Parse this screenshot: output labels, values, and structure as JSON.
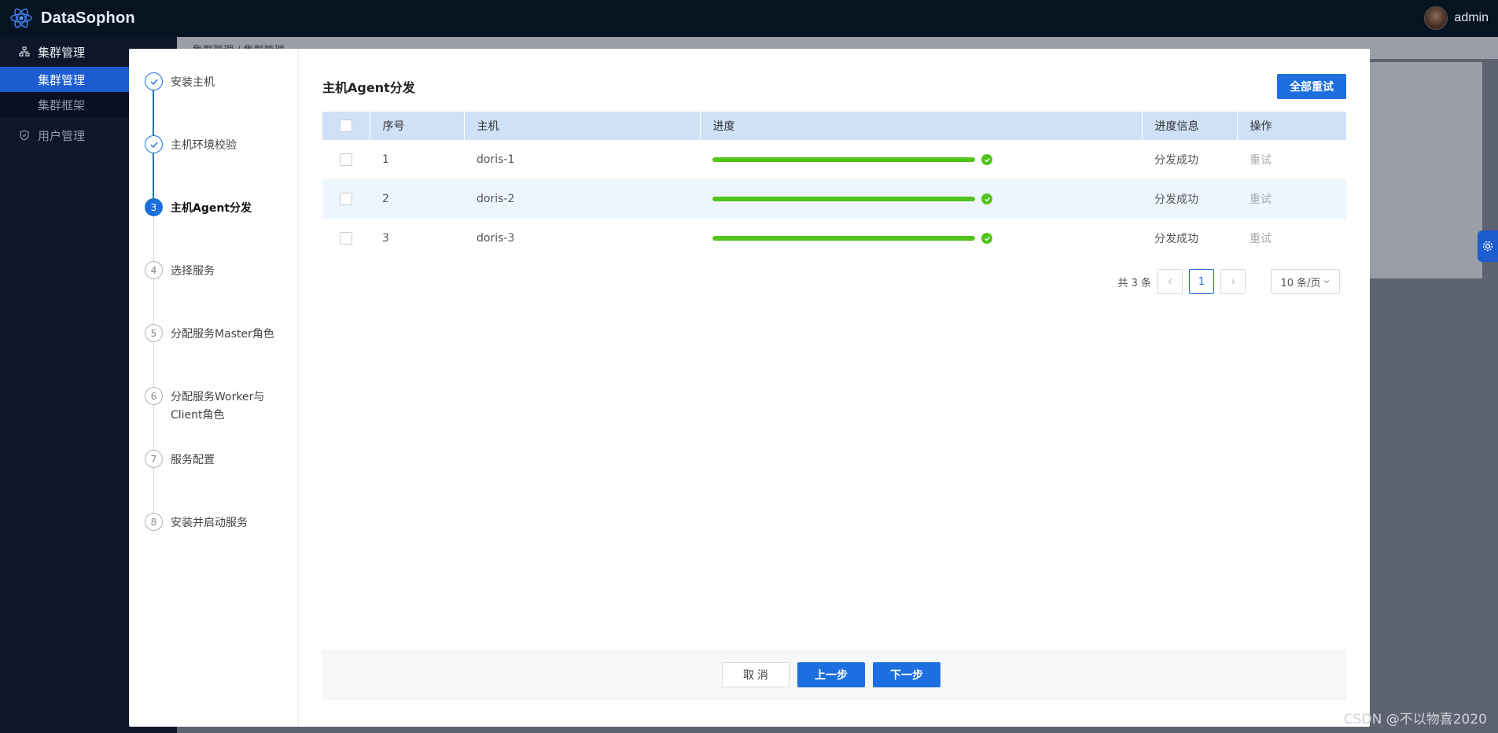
{
  "header": {
    "app_name": "DataSophon",
    "user_name": "admin"
  },
  "sidebar": {
    "group_label": "集群管理",
    "items": [
      {
        "label": "集群管理",
        "active": true
      },
      {
        "label": "集群框架",
        "active": false
      }
    ],
    "user_mgmt_label": "用户管理"
  },
  "background": {
    "breadcrumb": "集群管理 / 集群管理"
  },
  "steps": [
    {
      "num": "1",
      "label": "安装主机",
      "status": "done"
    },
    {
      "num": "2",
      "label": "主机环境校验",
      "status": "done"
    },
    {
      "num": "3",
      "label": "主机Agent分发",
      "status": "current"
    },
    {
      "num": "4",
      "label": "选择服务",
      "status": "pending"
    },
    {
      "num": "5",
      "label": "分配服务Master角色",
      "status": "pending"
    },
    {
      "num": "6",
      "label": "分配服务Worker与Client角色",
      "status": "pending"
    },
    {
      "num": "7",
      "label": "服务配置",
      "status": "pending"
    },
    {
      "num": "8",
      "label": "安装并启动服务",
      "status": "pending"
    }
  ],
  "section": {
    "title": "主机Agent分发",
    "retry_all_label": "全部重试"
  },
  "table": {
    "columns": [
      "序号",
      "主机",
      "进度",
      "进度信息",
      "操作"
    ],
    "rows": [
      {
        "index": "1",
        "host": "doris-1",
        "progress": 100,
        "info": "分发成功",
        "action": "重试"
      },
      {
        "index": "2",
        "host": "doris-2",
        "progress": 100,
        "info": "分发成功",
        "action": "重试"
      },
      {
        "index": "3",
        "host": "doris-3",
        "progress": 100,
        "info": "分发成功",
        "action": "重试"
      }
    ]
  },
  "pagination": {
    "total_text": "共 3 条",
    "current_page": "1",
    "page_size": "10 条/页"
  },
  "footer": {
    "cancel_label": "取 消",
    "prev_label": "上一步",
    "next_label": "下一步"
  },
  "watermark": "CSDN @不以物喜2020",
  "colors": {
    "primary": "#1d6fe0",
    "success": "#52c41a",
    "sidebar_active": "#1d5bd0"
  }
}
